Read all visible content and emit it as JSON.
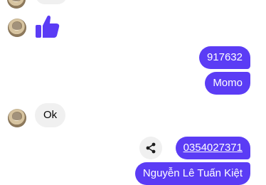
{
  "chat": {
    "messages": [
      {
        "sender": "other",
        "type": "reaction",
        "icon": "thumbs-up-icon",
        "color": "#5b3cf5"
      },
      {
        "sender": "me",
        "text": "917632"
      },
      {
        "sender": "me",
        "text": "Momo"
      },
      {
        "sender": "other",
        "text": "Ok"
      },
      {
        "sender": "me",
        "text": "0354027371",
        "link": true
      },
      {
        "sender": "me",
        "text": "Nguyễn Lê Tuấn Kiệt"
      }
    ]
  },
  "colors": {
    "outgoing_bubble": "#5b3cf5",
    "incoming_bubble": "#f0f0f0",
    "share_icon": "#1c1c1c"
  }
}
